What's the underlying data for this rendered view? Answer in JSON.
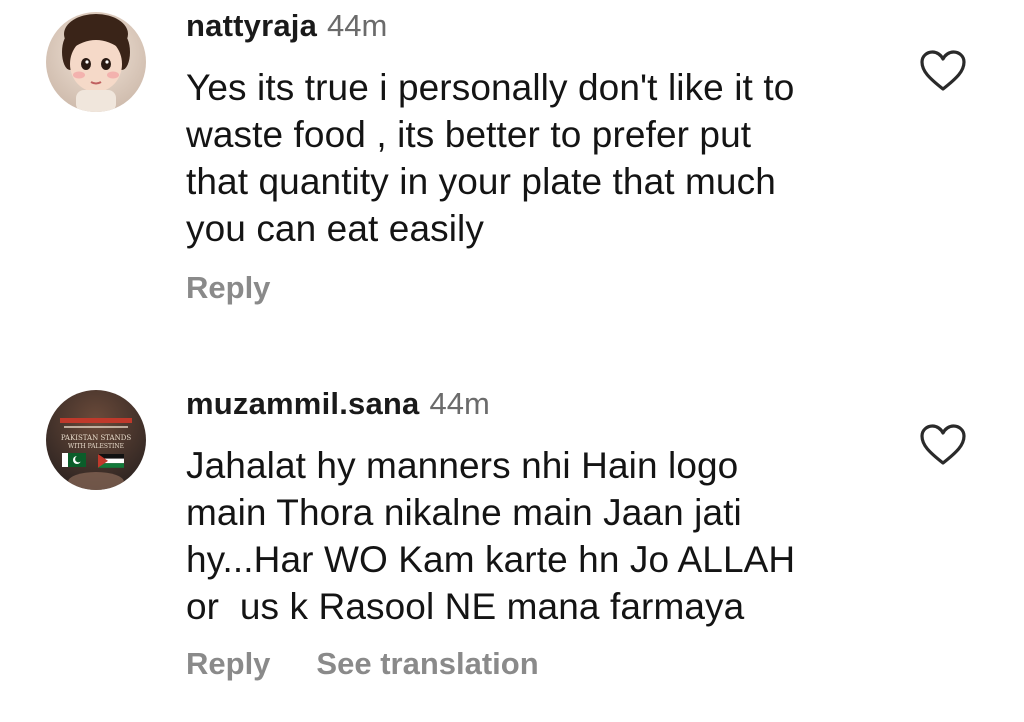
{
  "comments": [
    {
      "username": "nattyraja",
      "time": "44m",
      "lines": [
        "Yes its true i personally don't like it to",
        "waste food , its better to prefer put",
        "that quantity in your plate that much",
        "you can eat easily"
      ],
      "reply_label": "Reply",
      "avatar_icon": "cartoon-girl-avatar",
      "like_icon": "heart-outline-icon"
    },
    {
      "username": "muzammil.sana",
      "time": "44m",
      "lines": [
        "Jahalat hy manners nhi Hain logo",
        "main Thora nikalne main Jaan jati",
        "hy...Har WO Kam karte hn Jo ALLAH",
        "or  us k Rasool NE mana farmaya"
      ],
      "reply_label": "Reply",
      "translate_label": "See translation",
      "avatar_icon": "pakistan-palestine-poster-avatar",
      "avatar_text": [
        "PAKISTAN STANDS",
        "WITH PALESTINE"
      ],
      "like_icon": "heart-outline-icon"
    }
  ]
}
